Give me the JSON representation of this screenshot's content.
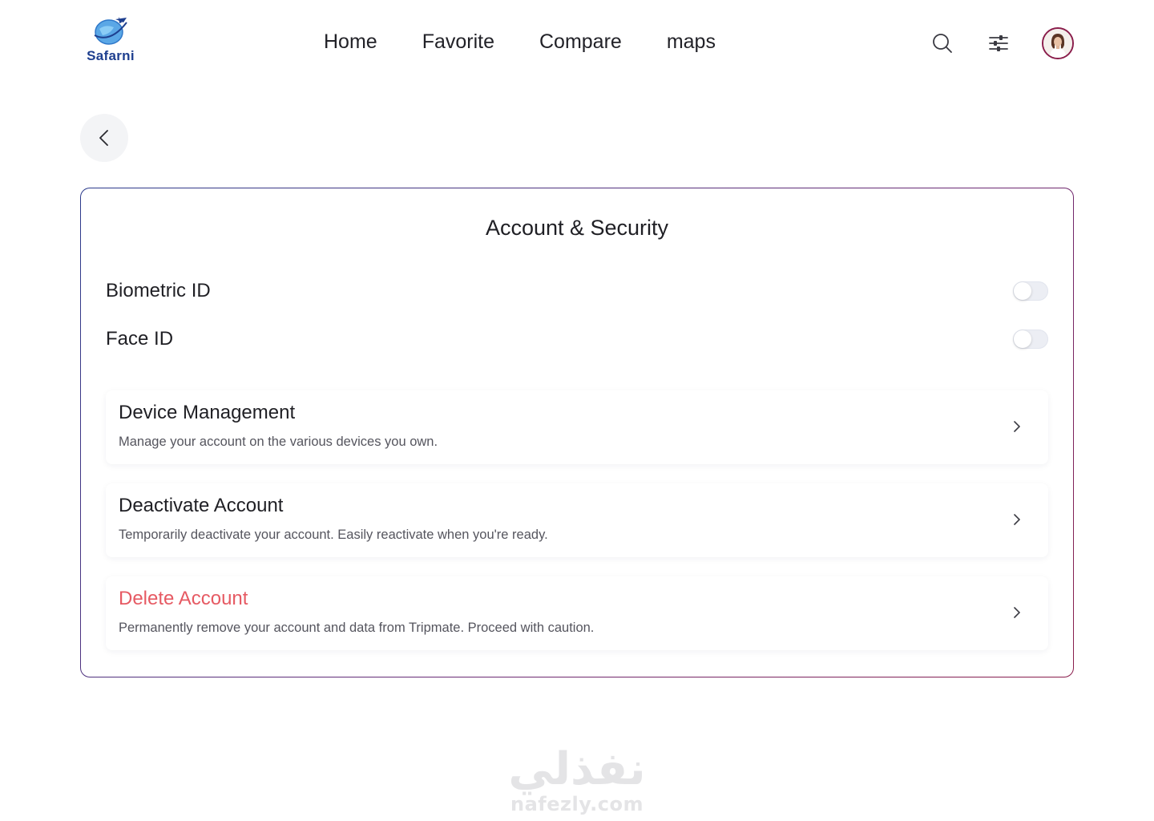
{
  "brand": {
    "name": "Safarni",
    "icon": "globe-plane-logo",
    "color": "#1e3f8f"
  },
  "nav": {
    "items": [
      {
        "label": "Home"
      },
      {
        "label": "Favorite"
      },
      {
        "label": "Compare"
      },
      {
        "label": "maps"
      }
    ]
  },
  "header_actions": {
    "search_icon": "search-icon",
    "filter_icon": "sliders-icon",
    "avatar_icon": "user-avatar"
  },
  "back": {
    "icon": "chevron-left-icon"
  },
  "card": {
    "title": "Account & Security",
    "toggles": [
      {
        "label": "Biometric ID",
        "on": false
      },
      {
        "label": "Face ID",
        "on": false
      }
    ],
    "items": [
      {
        "title": "Device Management",
        "description": "Manage your account on the various devices you own."
      },
      {
        "title": "Deactivate Account",
        "description": "Temporarily deactivate your account. Easily reactivate when you're ready."
      },
      {
        "title": "Delete Account",
        "description": "Permanently remove your account and data from Tripmate. Proceed with caution.",
        "danger": true
      }
    ]
  },
  "colors": {
    "danger": "#e65a63",
    "border_start": "#2b3b8c",
    "border_end": "#8a1d4b"
  },
  "watermark": {
    "arabic": "نفذلي",
    "latin": "nafezly.com"
  }
}
